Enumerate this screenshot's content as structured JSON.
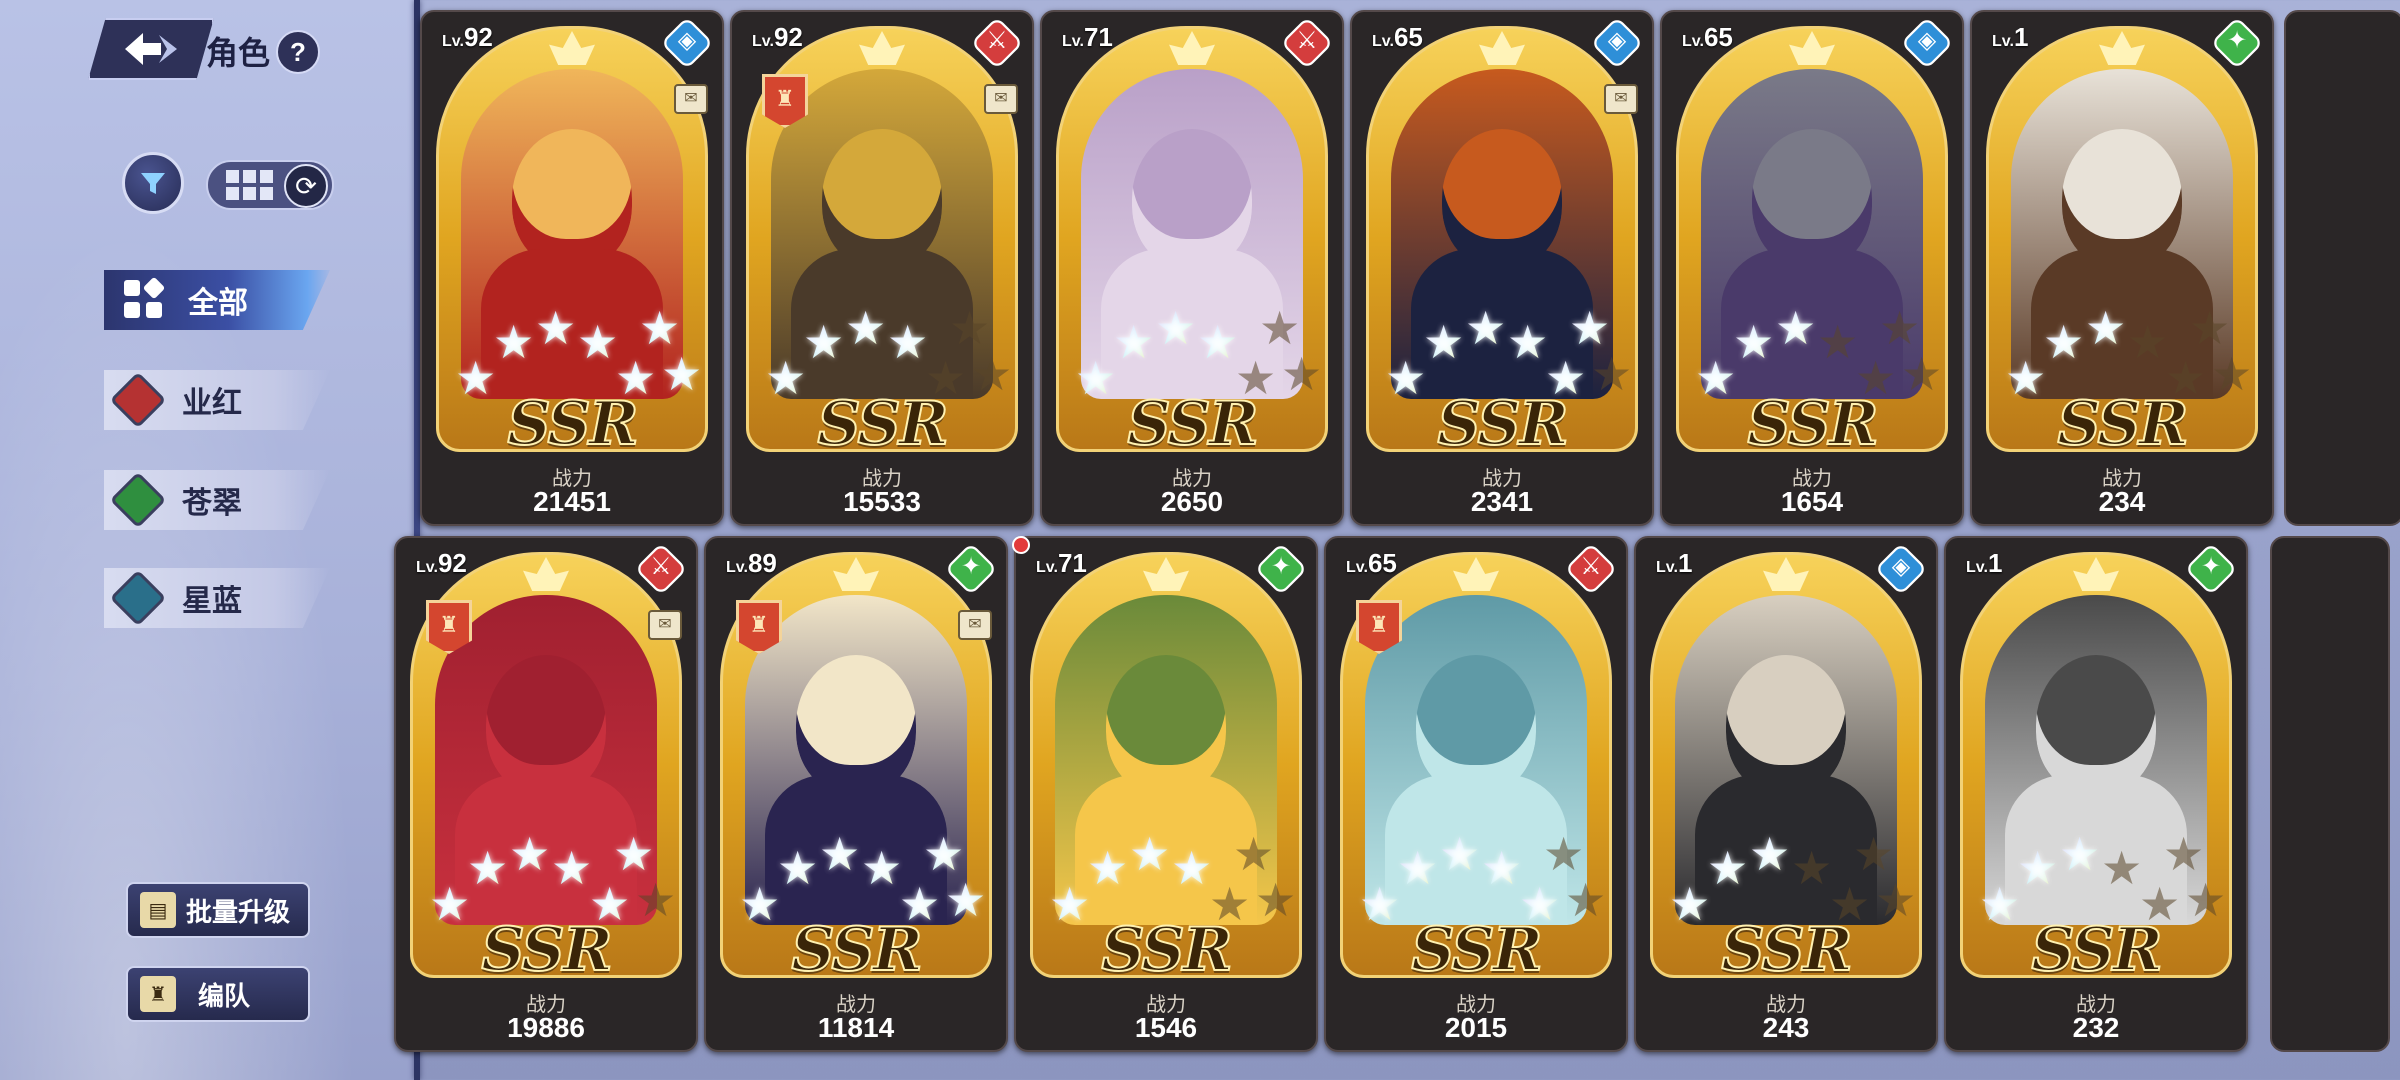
{
  "header": {
    "title": "角色",
    "help": "?"
  },
  "categories": [
    {
      "label": "全部",
      "active": true,
      "color": "#3b4fa4"
    },
    {
      "label": "业红",
      "active": false,
      "color": "#b53232"
    },
    {
      "label": "苍翠",
      "active": false,
      "color": "#2f8f3f"
    },
    {
      "label": "星蓝",
      "active": false,
      "color": "#2a6f8a"
    }
  ],
  "buttons": {
    "batch_upgrade": "批量升级",
    "formation": "编队"
  },
  "power_label": "战力",
  "rarity": "SSR",
  "cards": [
    {
      "level": "92",
      "element": "blue",
      "elem_color": "#2e8fd8",
      "stars": 7,
      "power": "21451",
      "scroll": true,
      "team": false,
      "art": [
        "#b2231f",
        "#f0b65a"
      ]
    },
    {
      "level": "92",
      "element": "red",
      "elem_color": "#d43d3d",
      "stars": 4,
      "power": "15533",
      "scroll": true,
      "team": true,
      "art": [
        "#4a3a2a",
        "#d4a83a"
      ]
    },
    {
      "level": "71",
      "element": "red",
      "elem_color": "#d43d3d",
      "stars": 4,
      "power": "2650",
      "scroll": false,
      "team": false,
      "art": [
        "#e4d6e8",
        "#b9a0c8"
      ]
    },
    {
      "level": "65",
      "element": "blue",
      "elem_color": "#2e8fd8",
      "stars": 6,
      "power": "2341",
      "scroll": true,
      "team": false,
      "art": [
        "#1c2240",
        "#c75a1e"
      ]
    },
    {
      "level": "65",
      "element": "blue",
      "elem_color": "#2e8fd8",
      "stars": 3,
      "power": "1654",
      "scroll": false,
      "team": false,
      "art": [
        "#4a3a6a",
        "#7a7a88"
      ]
    },
    {
      "level": "1",
      "element": "green",
      "elem_color": "#3fb34a",
      "stars": 3,
      "power": "234",
      "scroll": false,
      "team": false,
      "art": [
        "#5a3a26",
        "#e8e2d8"
      ]
    },
    {
      "level": "92",
      "element": "red",
      "elem_color": "#d43d3d",
      "stars": 6,
      "power": "19886",
      "scroll": true,
      "team": true,
      "art": [
        "#c8303e",
        "#a02030"
      ]
    },
    {
      "level": "89",
      "element": "green",
      "elem_color": "#3fb34a",
      "stars": 7,
      "power": "11814",
      "scroll": true,
      "team": true,
      "art": [
        "#2a2450",
        "#f2e6c8"
      ]
    },
    {
      "level": "71",
      "element": "green",
      "elem_color": "#3fb34a",
      "stars": 4,
      "power": "1546",
      "scroll": false,
      "team": false,
      "art": [
        "#f5c64a",
        "#6a8a3a"
      ]
    },
    {
      "level": "65",
      "element": "red",
      "elem_color": "#d43d3d",
      "stars": 5,
      "power": "2015",
      "scroll": false,
      "team": true,
      "art": [
        "#bfe6e8",
        "#5f9aa6"
      ]
    },
    {
      "level": "1",
      "element": "blue",
      "elem_color": "#2e8fd8",
      "stars": 3,
      "power": "243",
      "scroll": false,
      "team": false,
      "art": [
        "#2a2a2e",
        "#d8cfc0"
      ]
    },
    {
      "level": "1",
      "element": "green",
      "elem_color": "#3fb34a",
      "stars": 3,
      "power": "232",
      "scroll": false,
      "team": false,
      "art": [
        "#d8d8d8",
        "#4a4a4a"
      ]
    }
  ]
}
